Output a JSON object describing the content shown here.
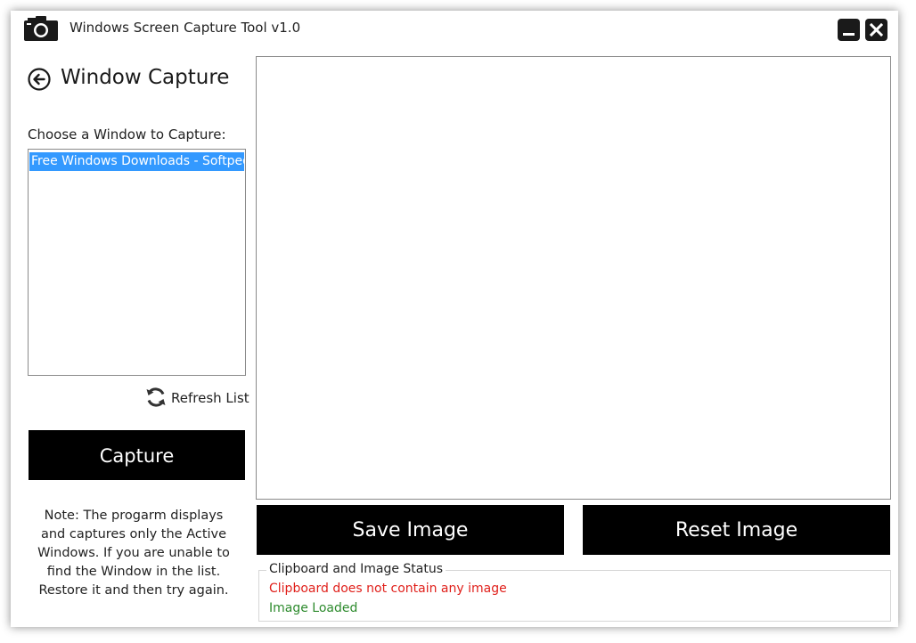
{
  "window": {
    "title": "Windows Screen Capture Tool v1.0",
    "app_icon": "camera-icon",
    "minimize_icon": "minimize-icon",
    "close_icon": "close-icon"
  },
  "sidebar": {
    "back_icon": "arrow-left-circle-icon",
    "heading": "Window Capture",
    "choose_label": "Choose a Window to Capture:",
    "window_list": [
      {
        "label": "Free Windows Downloads - Softpedia",
        "selected": true
      }
    ],
    "refresh_icon": "refresh-icon",
    "refresh_label": "Refresh List",
    "capture_label": "Capture",
    "note": "Note: The progarm displays and captures only the Active Windows. If you are unable to find the Window in the list. Restore it and then try again."
  },
  "main": {
    "save_label": "Save Image",
    "reset_label": "Reset Image",
    "status": {
      "legend": "Clipboard and Image Status",
      "clipboard_text": "Clipboard does not contain any image",
      "image_text": "Image Loaded"
    }
  },
  "colors": {
    "button_background": "#000000",
    "selection": "#3399ff",
    "error_text": "#e0201b",
    "ok_text": "#2e8b2e"
  }
}
